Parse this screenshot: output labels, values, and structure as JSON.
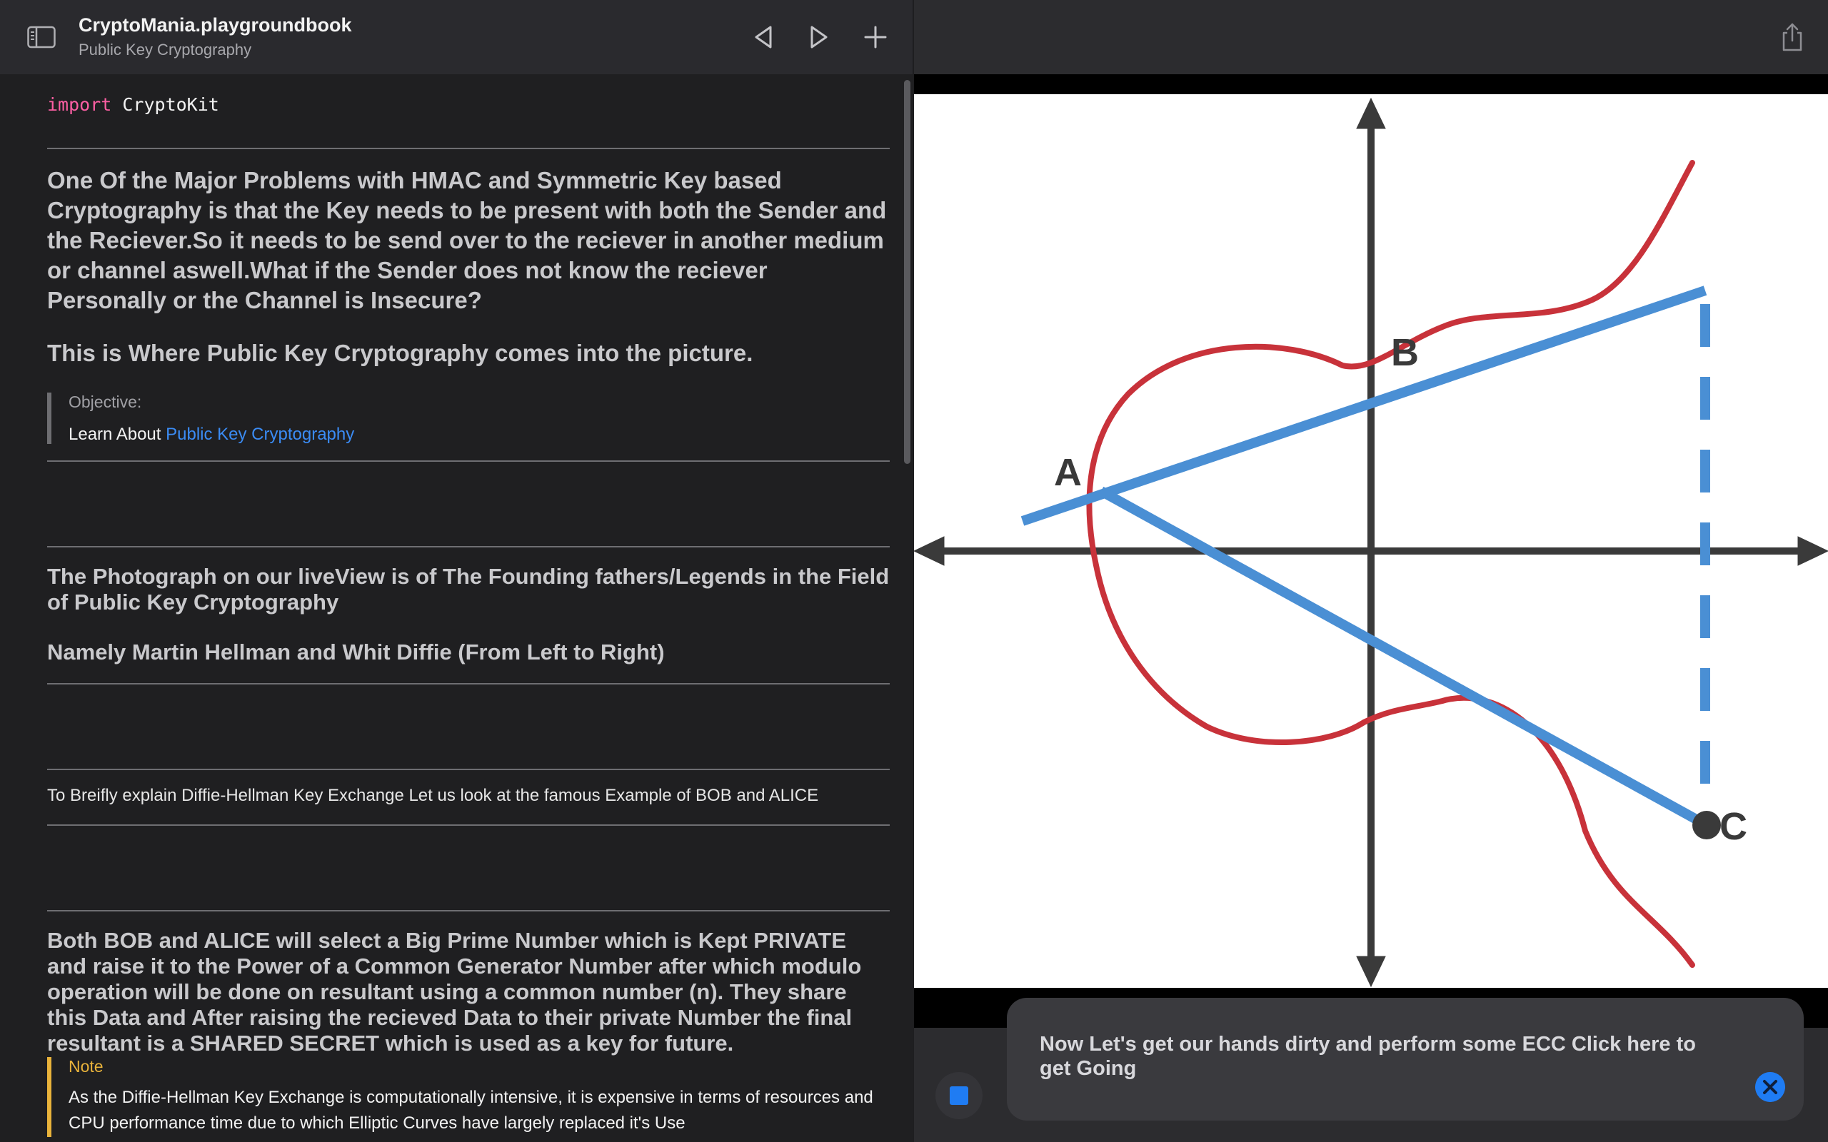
{
  "window": {
    "title": "CryptoMania.playgroundbook",
    "subtitle": "Public Key Cryptography"
  },
  "toolbar": {
    "icons": [
      "sidebar-icon",
      "back-triangle-icon",
      "forward-triangle-icon",
      "plus-icon",
      "share-icon"
    ]
  },
  "code": {
    "keyword": "import",
    "module": "CryptoKit"
  },
  "content": {
    "intro_paragraph": "One Of the Major Problems with HMAC and Symmetric Key based Cryptography is that the Key needs to be present with both the Sender and the Reciever.So it needs to be send over to the reciever in another medium or channel aswell.What if the Sender does not know the reciever Personally or the Channel is Insecure?",
    "intro_heading": "This is Where Public Key Cryptography comes into the picture.",
    "objective": {
      "title": "Objective:",
      "prefix": "Learn About",
      "link": "Public Key Cryptography"
    },
    "photo_heading": "The Photograph on our liveView is of The Founding fathers/Legends in the Field of Public Key Cryptography",
    "names_heading": "Namely Martin Hellman and Whit Diffie (From Left to Right)",
    "explain_line": "To Breifly explain Diffie-Hellman Key Exchange Let us look at the famous Example of BOB and ALICE",
    "dh_paragraph": "Both BOB and ALICE will select a Big Prime Number which is Kept PRIVATE and raise it to the Power of a Common Generator Number after which modulo operation will be done on resultant using a common number (n). They share this Data and After raising the recieved Data to their private Number the final resultant is a SHARED SECRET which is used as a key for future.",
    "note": {
      "title": "Note",
      "body": "As the Diffie-Hellman Key Exchange is computationally intensive, it is expensive in terms of resources and CPU performance time due to which Elliptic Curves have largely replaced it's Use"
    }
  },
  "live_view": {
    "figure": {
      "point_labels": [
        "A",
        "B",
        "C"
      ],
      "colors": {
        "curve": "#c8323a",
        "line": "#4a8fd4",
        "axes": "#3a3a3a"
      }
    },
    "toast": {
      "text": "Now Let's get our hands dirty and perform some ECC Click here to get Going"
    },
    "colors": {
      "accent": "#1f7cf3"
    }
  }
}
